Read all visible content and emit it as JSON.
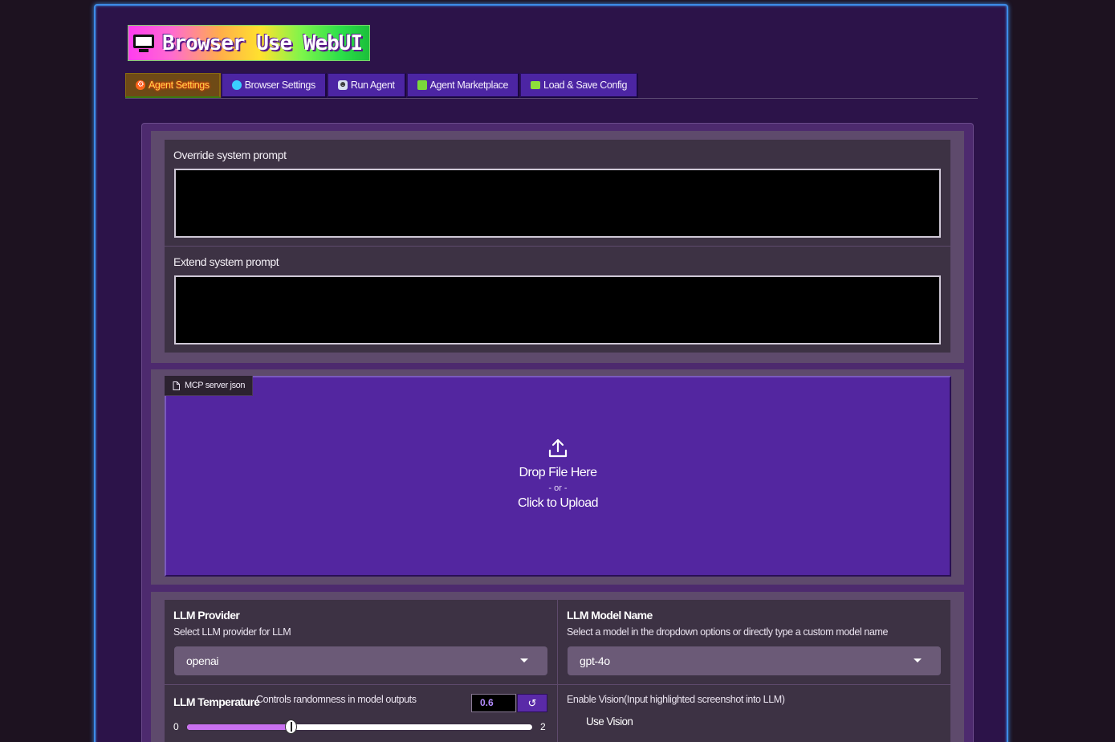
{
  "header": {
    "title": "Browser Use WebUI",
    "logo_icon": "monitor-icon"
  },
  "tabs": [
    {
      "label": "Agent Settings",
      "icon": "gear-icon",
      "active": true
    },
    {
      "label": "Browser Settings",
      "icon": "globe-icon",
      "active": false
    },
    {
      "label": "Run Agent",
      "icon": "robot-icon",
      "active": false
    },
    {
      "label": "Agent Marketplace",
      "icon": "gift-icon",
      "active": false
    },
    {
      "label": "Load & Save Config",
      "icon": "folder-icon",
      "active": false
    }
  ],
  "prompts": {
    "override_label": "Override system prompt",
    "override_value": "",
    "extend_label": "Extend system prompt",
    "extend_value": ""
  },
  "upload": {
    "tag_label": "MCP server json",
    "drop_text": "Drop File Here",
    "or_text": "- or -",
    "click_text": "Click to Upload"
  },
  "llm": {
    "provider_title": "LLM Provider",
    "provider_info": "Select LLM provider for LLM",
    "provider_value": "openai",
    "model_title": "LLM Model Name",
    "model_info": "Select a model in the dropdown options or directly type a custom model name",
    "model_value": "gpt-4o",
    "temperature_title": "LLM Temperature",
    "temperature_info": "Controls randomness in model outputs",
    "temperature_value": "0.6",
    "temperature_min": "0",
    "temperature_max": "2",
    "temperature_fraction": 0.3,
    "reset_symbol": "↺",
    "vision_info": "Enable Vision(Input highlighted screenshot into LLM)",
    "vision_label": "Use Vision"
  },
  "colors": {
    "frame_border": "#3d8ce8",
    "tab_bg": "#4c25a3",
    "upload_bg": "#5326a0",
    "slider_fill": "#c970f0"
  }
}
